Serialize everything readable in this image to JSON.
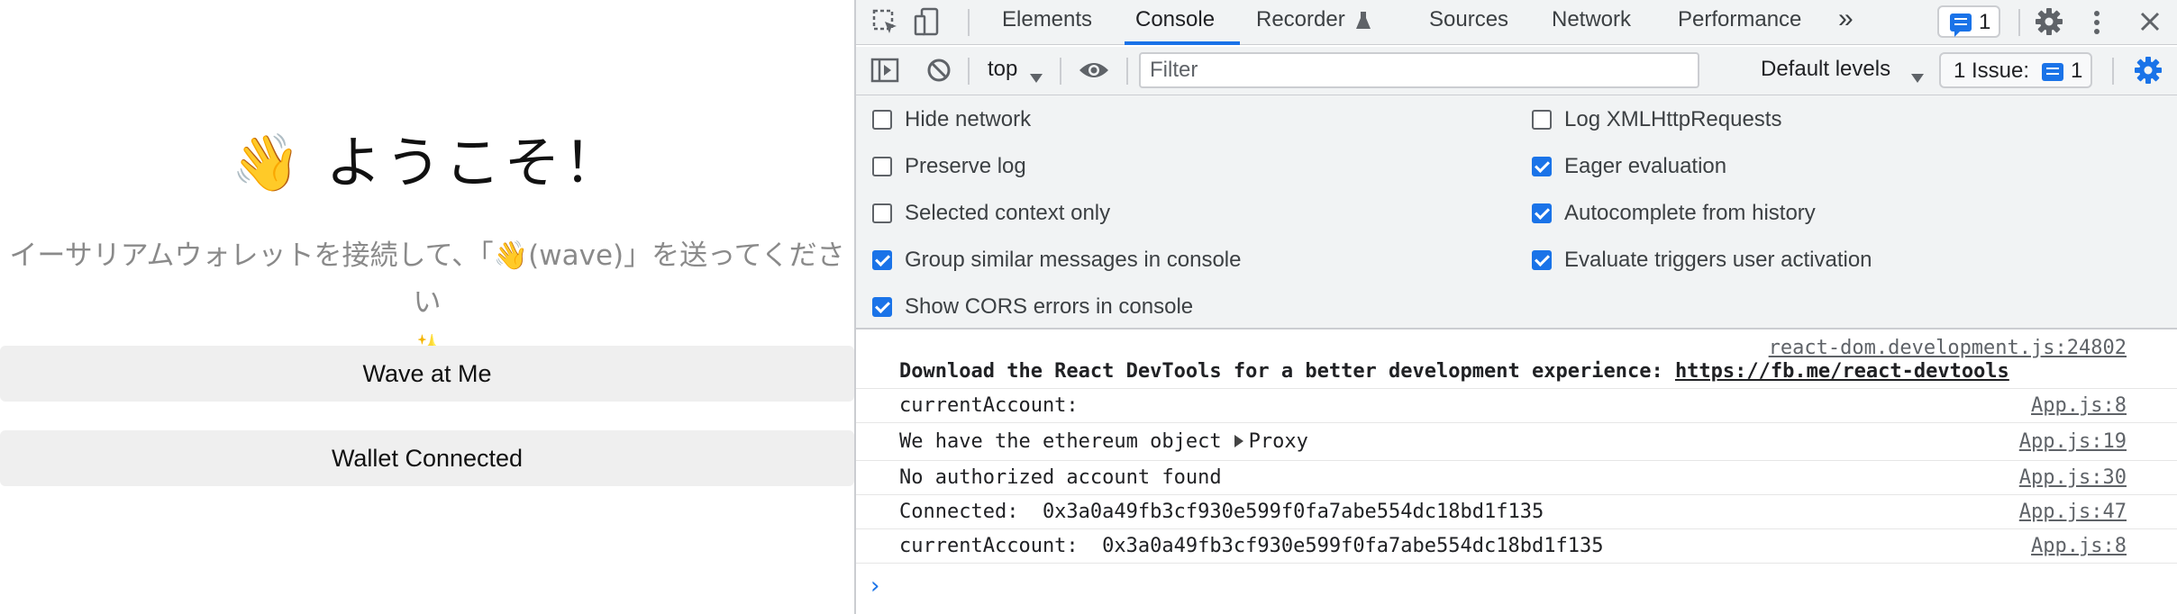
{
  "app": {
    "heading": "👋 ようこそ！",
    "bio_line1": "イーサリアムウォレットを接続して、「👋(wave)」を送ってください",
    "bio_line2": "✨",
    "wave_button": "Wave at Me",
    "wallet_button": "Wallet Connected"
  },
  "devtools": {
    "tabs": [
      {
        "label": "Elements",
        "active": false
      },
      {
        "label": "Console",
        "active": true
      },
      {
        "label": "Recorder",
        "active": false
      },
      {
        "label": "Sources",
        "active": false
      },
      {
        "label": "Network",
        "active": false
      },
      {
        "label": "Performance",
        "active": false
      }
    ],
    "more_tabs": "»",
    "message_count": "1",
    "toolbar": {
      "context": "top",
      "filter_placeholder": "Filter",
      "levels": "Default levels",
      "issues_label": "1 Issue:",
      "issues_count": "1"
    },
    "settings": {
      "left": [
        {
          "label": "Hide network",
          "checked": false
        },
        {
          "label": "Preserve log",
          "checked": false
        },
        {
          "label": "Selected context only",
          "checked": false
        },
        {
          "label": "Group similar messages in console",
          "checked": true
        },
        {
          "label": "Show CORS errors in console",
          "checked": true
        }
      ],
      "right": [
        {
          "label": "Log XMLHttpRequests",
          "checked": false
        },
        {
          "label": "Eager evaluation",
          "checked": true
        },
        {
          "label": "Autocomplete from history",
          "checked": true
        },
        {
          "label": "Evaluate triggers user activation",
          "checked": true
        }
      ]
    },
    "console": {
      "first": {
        "source": "react-dom.development.js:24802",
        "text": "Download the React DevTools for a better development experience: ",
        "link": "https://fb.me/react-devtools"
      },
      "rows": [
        {
          "text": "currentAccount: ",
          "source": "App.js:8"
        },
        {
          "text": "We have the ethereum object",
          "object": "Proxy",
          "source": "App.js:19"
        },
        {
          "text": "No authorized account found",
          "source": "App.js:30"
        },
        {
          "text": "Connected:  0x3a0a49fb3cf930e599f0fa7abe554dc18bd1f135",
          "source": "App.js:47"
        },
        {
          "text": "currentAccount:  0x3a0a49fb3cf930e599f0fa7abe554dc18bd1f135",
          "source": "App.js:8"
        }
      ],
      "prompt": "›"
    }
  }
}
